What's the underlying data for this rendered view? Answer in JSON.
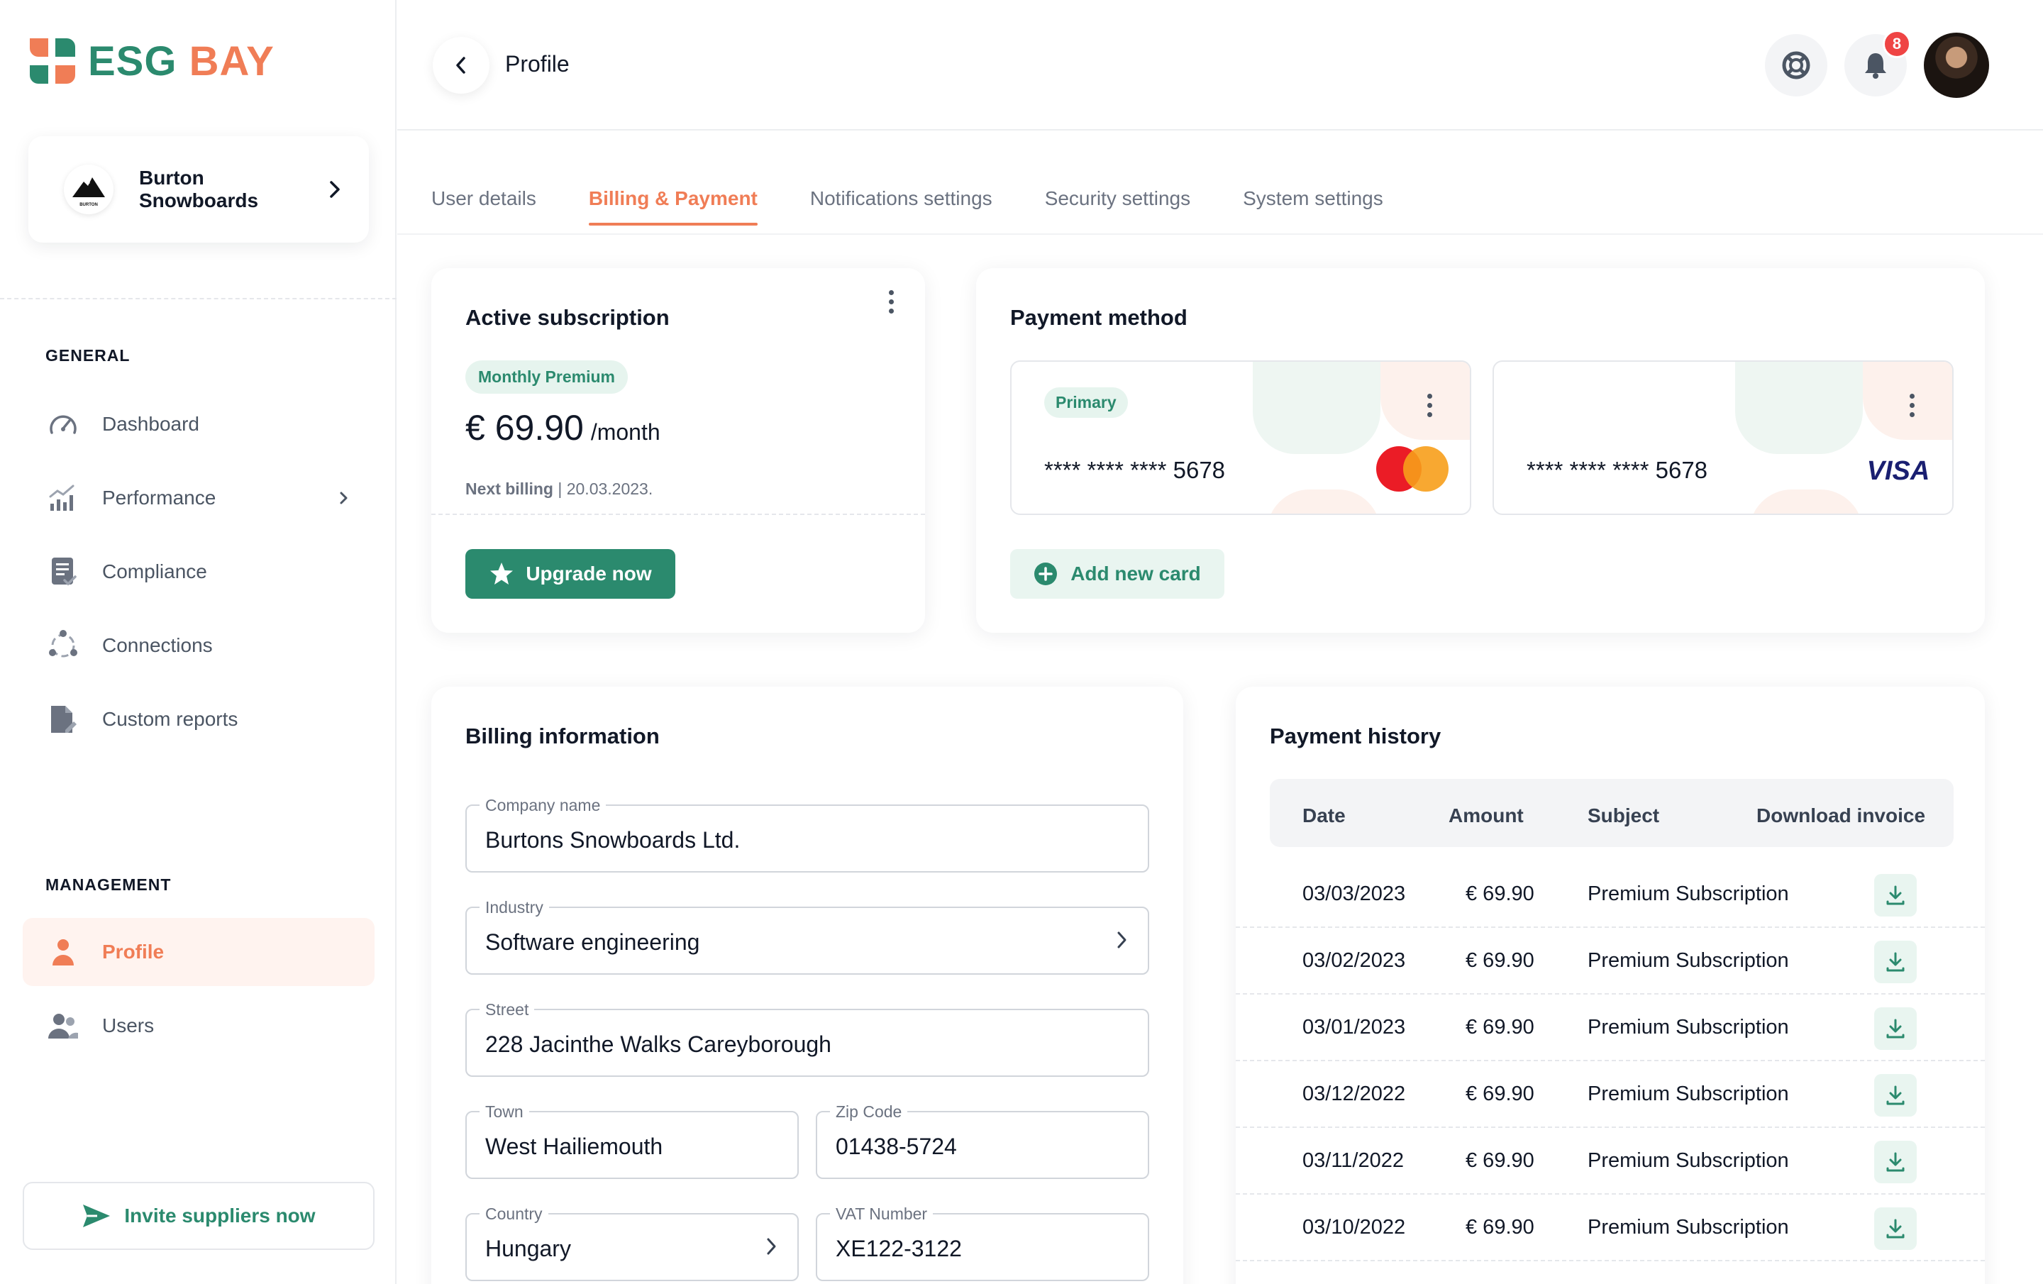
{
  "brand": {
    "name_part1": "ESG",
    "name_part2": "BAY"
  },
  "organization": {
    "name": "Burton Snowboards",
    "logo_text": "BURTON"
  },
  "sidebar": {
    "general_label": "GENERAL",
    "general_items": [
      {
        "label": "Dashboard",
        "icon": "speedometer-icon"
      },
      {
        "label": "Performance",
        "icon": "bar-chart-icon"
      },
      {
        "label": "Compliance",
        "icon": "checklist-icon"
      },
      {
        "label": "Connections",
        "icon": "connections-icon"
      },
      {
        "label": "Custom reports",
        "icon": "report-icon"
      }
    ],
    "management_label": "MANAGEMENT",
    "management_items": [
      {
        "label": "Profile",
        "icon": "user-icon",
        "active": true
      },
      {
        "label": "Users",
        "icon": "users-icon"
      }
    ],
    "invite_label": "Invite suppliers now"
  },
  "header": {
    "title": "Profile",
    "notification_count": "8"
  },
  "tabs": [
    {
      "label": "User details"
    },
    {
      "label": "Billing & Payment",
      "active": true
    },
    {
      "label": "Notifications settings"
    },
    {
      "label": "Security settings"
    },
    {
      "label": "System settings"
    }
  ],
  "subscription": {
    "title": "Active subscription",
    "plan": "Monthly Premium",
    "price": "€ 69.90",
    "period": "/month",
    "next_billing_label": "Next billing",
    "next_billing_date": "20.03.2023.",
    "upgrade_label": "Upgrade now"
  },
  "payment_method": {
    "title": "Payment method",
    "primary_label": "Primary",
    "cards": [
      {
        "number": "**** **** **** 5678",
        "brand": "mastercard"
      },
      {
        "number": "**** **** **** 5678",
        "brand": "VISA"
      }
    ],
    "add_card_label": "Add new card"
  },
  "billing_info": {
    "title": "Billing information",
    "company_label": "Company name",
    "company_value": "Burtons Snowboards Ltd.",
    "industry_label": "Industry",
    "industry_value": "Software engineering",
    "street_label": "Street",
    "street_value": "228 Jacinthe Walks Careyborough",
    "town_label": "Town",
    "town_value": "West Hailiemouth",
    "zip_label": "Zip Code",
    "zip_value": "01438-5724",
    "country_label": "Country",
    "country_value": "Hungary",
    "vat_label": "VAT Number",
    "vat_value": "XE122-3122"
  },
  "payment_history": {
    "title": "Payment history",
    "columns": [
      "Date",
      "Amount",
      "Subject",
      "Download invoice"
    ],
    "rows": [
      {
        "date": "03/03/2023",
        "amount": "€ 69.90",
        "subject": "Premium Subscription"
      },
      {
        "date": "03/02/2023",
        "amount": "€ 69.90",
        "subject": "Premium Subscription"
      },
      {
        "date": "03/01/2023",
        "amount": "€ 69.90",
        "subject": "Premium Subscription"
      },
      {
        "date": "03/12/2022",
        "amount": "€ 69.90",
        "subject": "Premium Subscription"
      },
      {
        "date": "03/11/2022",
        "amount": "€ 69.90",
        "subject": "Premium Subscription"
      },
      {
        "date": "03/10/2022",
        "amount": "€ 69.90",
        "subject": "Premium Subscription"
      }
    ]
  },
  "colors": {
    "brand_green": "#2b8a6e",
    "brand_orange": "#f07d56",
    "badge_red": "#ef4444"
  }
}
